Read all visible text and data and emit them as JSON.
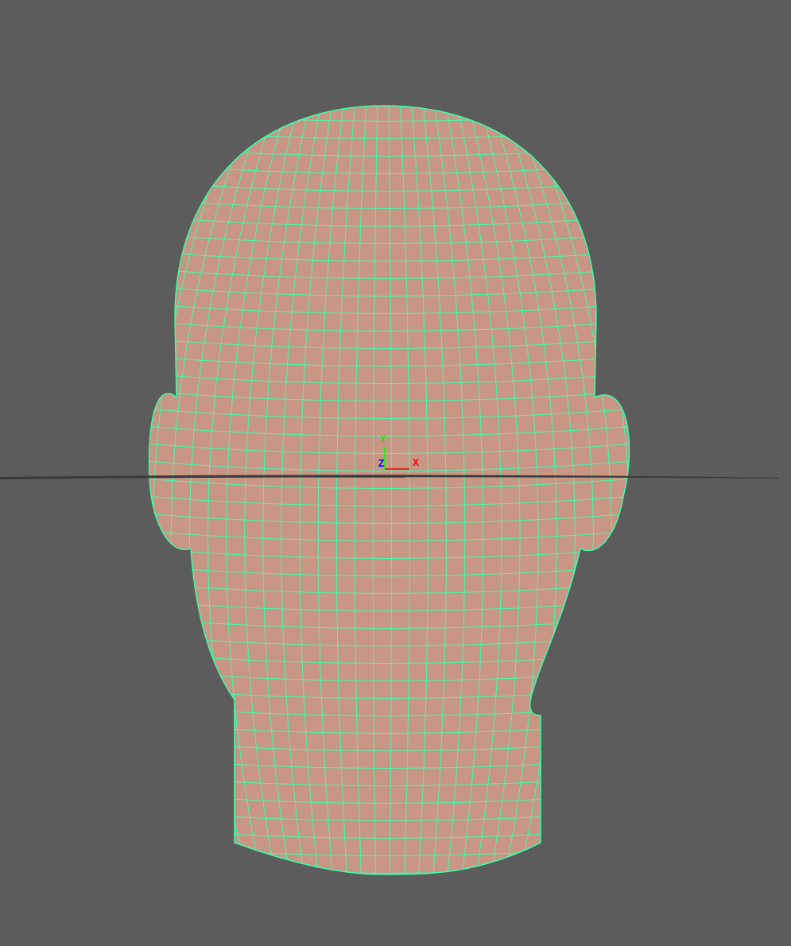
{
  "viewport": {
    "axes": [
      {
        "kind": "y",
        "label": "Y",
        "color": "#00ff00"
      },
      {
        "kind": "z",
        "label": "Z",
        "color": "#0000ff"
      },
      {
        "kind": "x",
        "label": "X",
        "color": "#ff0000"
      }
    ]
  }
}
